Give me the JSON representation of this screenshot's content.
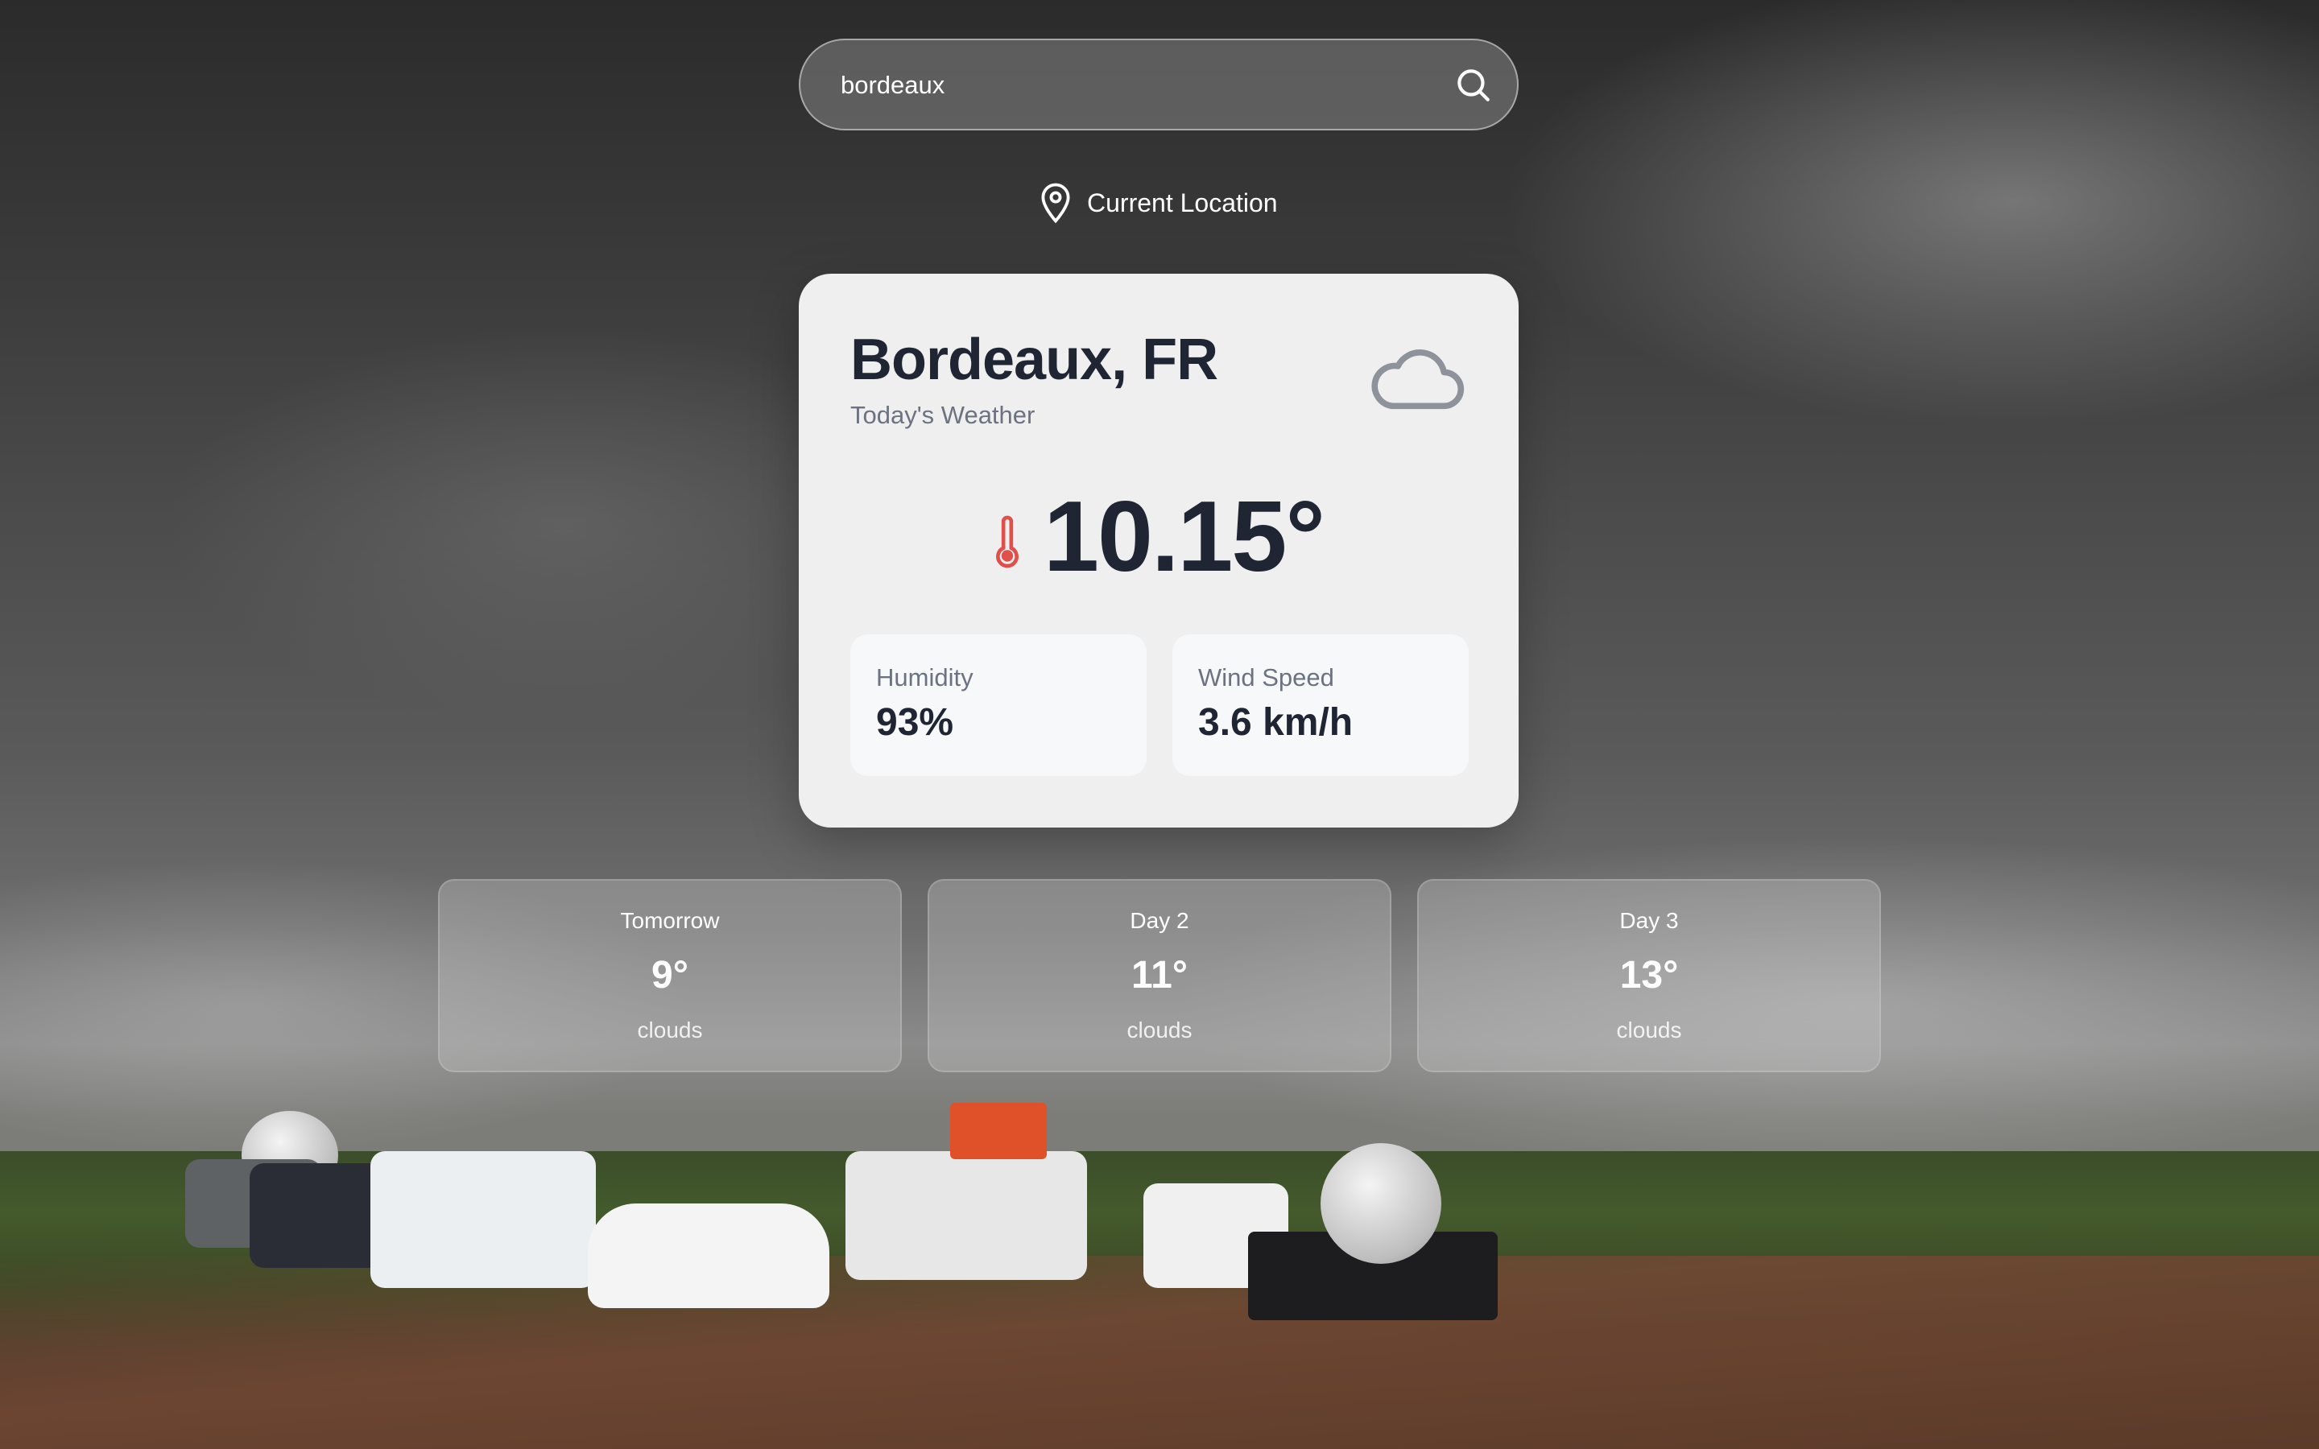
{
  "search": {
    "value": "bordeaux"
  },
  "location_button": {
    "label": "Current Location"
  },
  "current": {
    "city": "Bordeaux, FR",
    "subtitle": "Today's Weather",
    "temperature": "10.15°",
    "condition_icon": "cloud-icon",
    "humidity_label": "Humidity",
    "humidity_value": "93%",
    "wind_label": "Wind Speed",
    "wind_value": "3.6 km/h"
  },
  "forecast": [
    {
      "day": "Tomorrow",
      "temp": "9°",
      "desc": "clouds"
    },
    {
      "day": "Day 2",
      "temp": "11°",
      "desc": "clouds"
    },
    {
      "day": "Day 3",
      "temp": "13°",
      "desc": "clouds"
    }
  ],
  "colors": {
    "card_bg": "#efeff0",
    "text_dark": "#1f2533",
    "text_muted": "#6b7280",
    "thermometer": "#e0504a"
  }
}
